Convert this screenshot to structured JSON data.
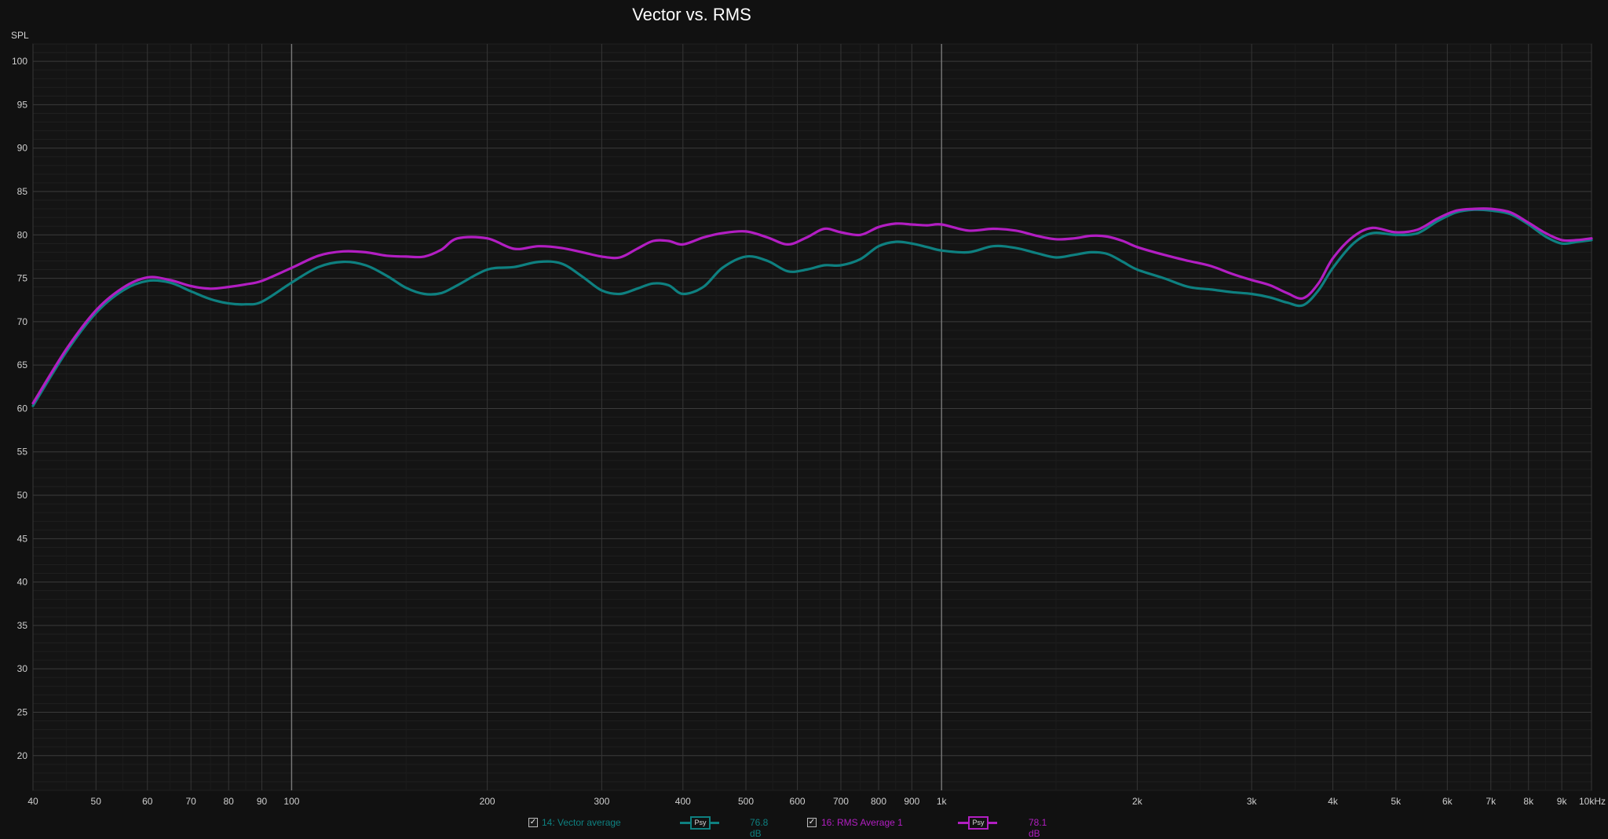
{
  "title": "Vector vs. RMS",
  "legend": [
    {
      "checked": "✓",
      "label": "14: Vector average",
      "swatch": "Psy",
      "value": "76.8 dB",
      "color": "#0e8080"
    },
    {
      "checked": "✓",
      "label": "16: RMS Average 1",
      "swatch": "Psy",
      "value": "78.1 dB",
      "color": "#b21ec2"
    }
  ],
  "chart_data": {
    "type": "line",
    "title": "Vector vs. RMS",
    "ylabel": "SPL",
    "xlabel": "",
    "x_scale": "log",
    "xlim": [
      40,
      10000
    ],
    "ylim": [
      16,
      102
    ],
    "grid": true,
    "x_ticks": [
      {
        "v": 40,
        "label": "40"
      },
      {
        "v": 50,
        "label": "50"
      },
      {
        "v": 60,
        "label": "60"
      },
      {
        "v": 70,
        "label": "70"
      },
      {
        "v": 80,
        "label": "80"
      },
      {
        "v": 90,
        "label": "90"
      },
      {
        "v": 100,
        "label": "100"
      },
      {
        "v": 200,
        "label": "200"
      },
      {
        "v": 300,
        "label": "300"
      },
      {
        "v": 400,
        "label": "400"
      },
      {
        "v": 500,
        "label": "500"
      },
      {
        "v": 600,
        "label": "600"
      },
      {
        "v": 700,
        "label": "700"
      },
      {
        "v": 800,
        "label": "800"
      },
      {
        "v": 900,
        "label": "900"
      },
      {
        "v": 1000,
        "label": "1k"
      },
      {
        "v": 2000,
        "label": "2k"
      },
      {
        "v": 3000,
        "label": "3k"
      },
      {
        "v": 4000,
        "label": "4k"
      },
      {
        "v": 5000,
        "label": "5k"
      },
      {
        "v": 6000,
        "label": "6k"
      },
      {
        "v": 7000,
        "label": "7k"
      },
      {
        "v": 8000,
        "label": "8k"
      },
      {
        "v": 9000,
        "label": "9k"
      },
      {
        "v": 10000,
        "label": "10kHz"
      }
    ],
    "y_ticks": [
      20,
      25,
      30,
      35,
      40,
      45,
      50,
      55,
      60,
      65,
      70,
      75,
      80,
      85,
      90,
      95,
      100
    ],
    "series": [
      {
        "name": "14: Vector average",
        "color": "#0e8080",
        "x": [
          40,
          45,
          50,
          55,
          60,
          65,
          70,
          75,
          80,
          85,
          90,
          100,
          110,
          120,
          130,
          140,
          150,
          160,
          170,
          180,
          200,
          220,
          240,
          260,
          280,
          300,
          320,
          340,
          360,
          380,
          400,
          430,
          460,
          500,
          540,
          580,
          620,
          660,
          700,
          750,
          800,
          850,
          900,
          950,
          1000,
          1100,
          1200,
          1300,
          1400,
          1500,
          1600,
          1700,
          1800,
          1900,
          2000,
          2200,
          2400,
          2600,
          2800,
          3000,
          3200,
          3400,
          3600,
          3800,
          4000,
          4300,
          4600,
          5000,
          5400,
          5800,
          6200,
          6600,
          7000,
          7500,
          8000,
          8500,
          9000,
          9500,
          10000
        ],
        "y": [
          60.3,
          66.5,
          71.0,
          73.6,
          74.7,
          74.5,
          73.5,
          72.6,
          72.1,
          72.0,
          72.3,
          74.5,
          76.3,
          76.9,
          76.5,
          75.3,
          73.9,
          73.2,
          73.3,
          74.2,
          76.0,
          76.3,
          76.9,
          76.7,
          75.2,
          73.6,
          73.2,
          73.8,
          74.4,
          74.2,
          73.2,
          74.0,
          76.2,
          77.5,
          77.0,
          75.8,
          76.0,
          76.5,
          76.5,
          77.2,
          78.7,
          79.2,
          79.0,
          78.6,
          78.2,
          78.0,
          78.7,
          78.5,
          77.9,
          77.4,
          77.7,
          78.0,
          77.8,
          76.9,
          76.0,
          75.0,
          74.0,
          73.7,
          73.4,
          73.2,
          72.8,
          72.2,
          71.9,
          73.6,
          76.2,
          79.0,
          80.2,
          80.0,
          80.2,
          81.6,
          82.6,
          82.9,
          82.8,
          82.4,
          81.2,
          79.8,
          79.0,
          79.2,
          79.4
        ]
      },
      {
        "name": "16: RMS Average 1",
        "color": "#b21ec2",
        "x": [
          40,
          45,
          50,
          55,
          60,
          65,
          70,
          75,
          80,
          85,
          90,
          100,
          110,
          120,
          130,
          140,
          150,
          160,
          170,
          180,
          200,
          220,
          240,
          260,
          280,
          300,
          320,
          340,
          360,
          380,
          400,
          430,
          460,
          500,
          540,
          580,
          620,
          660,
          700,
          750,
          800,
          850,
          900,
          950,
          1000,
          1100,
          1200,
          1300,
          1400,
          1500,
          1600,
          1700,
          1800,
          1900,
          2000,
          2200,
          2400,
          2600,
          2800,
          3000,
          3200,
          3400,
          3600,
          3800,
          4000,
          4300,
          4600,
          5000,
          5400,
          5800,
          6200,
          6600,
          7000,
          7500,
          8000,
          8500,
          9000,
          9500,
          10000
        ],
        "y": [
          60.6,
          66.8,
          71.3,
          73.9,
          75.1,
          74.8,
          74.1,
          73.8,
          74.0,
          74.3,
          74.7,
          76.2,
          77.6,
          78.1,
          78.0,
          77.6,
          77.5,
          77.5,
          78.3,
          79.6,
          79.6,
          78.4,
          78.7,
          78.5,
          78.0,
          77.5,
          77.4,
          78.4,
          79.3,
          79.3,
          78.9,
          79.7,
          80.2,
          80.4,
          79.7,
          78.9,
          79.7,
          80.7,
          80.3,
          80.0,
          80.9,
          81.3,
          81.2,
          81.1,
          81.2,
          80.5,
          80.7,
          80.5,
          79.9,
          79.5,
          79.6,
          79.9,
          79.8,
          79.3,
          78.6,
          77.7,
          77.0,
          76.4,
          75.5,
          74.8,
          74.2,
          73.3,
          72.7,
          74.4,
          77.3,
          79.8,
          80.8,
          80.3,
          80.6,
          81.9,
          82.8,
          83.0,
          83.0,
          82.6,
          81.4,
          80.2,
          79.4,
          79.4,
          79.6
        ]
      }
    ]
  }
}
